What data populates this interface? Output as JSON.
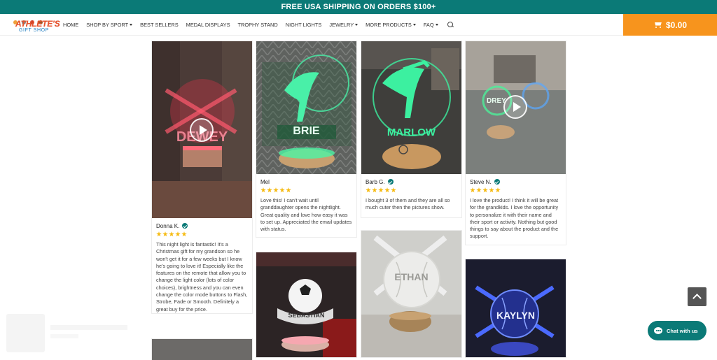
{
  "promo_bar": {
    "text": "FREE USA SHIPPING ON ORDERS $100+"
  },
  "logo": {
    "line1": "ATHLETE'S",
    "line2": "GIFT SHOP"
  },
  "nav": {
    "items": [
      {
        "label": "HOME",
        "dropdown": false
      },
      {
        "label": "SHOP BY SPORT",
        "dropdown": true
      },
      {
        "label": "BEST SELLERS",
        "dropdown": false
      },
      {
        "label": "MEDAL DISPLAYS",
        "dropdown": false
      },
      {
        "label": "TROPHY STAND",
        "dropdown": false
      },
      {
        "label": "NIGHT LIGHTS",
        "dropdown": false
      },
      {
        "label": "JEWELRY",
        "dropdown": true
      },
      {
        "label": "MORE PRODUCTS",
        "dropdown": true
      },
      {
        "label": "FAQ",
        "dropdown": true
      }
    ],
    "search_icon": "search-icon"
  },
  "cart": {
    "total": "$0.00",
    "icon": "cart-icon"
  },
  "reviews": {
    "donna": {
      "name": "Donna K.",
      "verified": true,
      "rating": 5,
      "photo_text": "DEWEY",
      "text": "This night light is fantastic! It's a Christmas gift for my grandson so he won't get it for a few weeks but I know he's going to love it! Especially like the features on the remote that allow you to change the light color (lots of color choices), brightness and you can even change the color mode buttons to Flash, Strobe, Fade or Smooth. Definitely a great buy for the price."
    },
    "mel": {
      "name": "Mel",
      "verified": false,
      "rating": 5,
      "photo_text": "BRIE",
      "text": "Love this! I can't wait until granddaughter opens the nightlight. Great quality and love how easy it was to set up. Appreciated the email updates with status."
    },
    "barb": {
      "name": "Barb G.",
      "verified": true,
      "rating": 5,
      "photo_text": "MARLOW",
      "text": "I bought 3 of them and they are all so much cuter then the pictures show."
    },
    "steve": {
      "name": "Steve N.",
      "verified": true,
      "rating": 5,
      "photo_text": "DREY",
      "text": "I love the product! I think it will be great for the grandkids. I love the opportunity to personalize it with their name and their sport or activity. Nothing but good things to say about the product and the support."
    },
    "photo_sebastian": {
      "photo_text": "SEBASTIAN"
    },
    "photo_ethan": {
      "photo_text": "ETHAN"
    },
    "photo_kaylyn": {
      "photo_text": "KAYLYN"
    }
  },
  "chat": {
    "label": "Chat with us"
  },
  "colors": {
    "brand_teal": "#0b7a77",
    "cart_orange": "#f7941d",
    "star_gold": "#f5b90e"
  }
}
